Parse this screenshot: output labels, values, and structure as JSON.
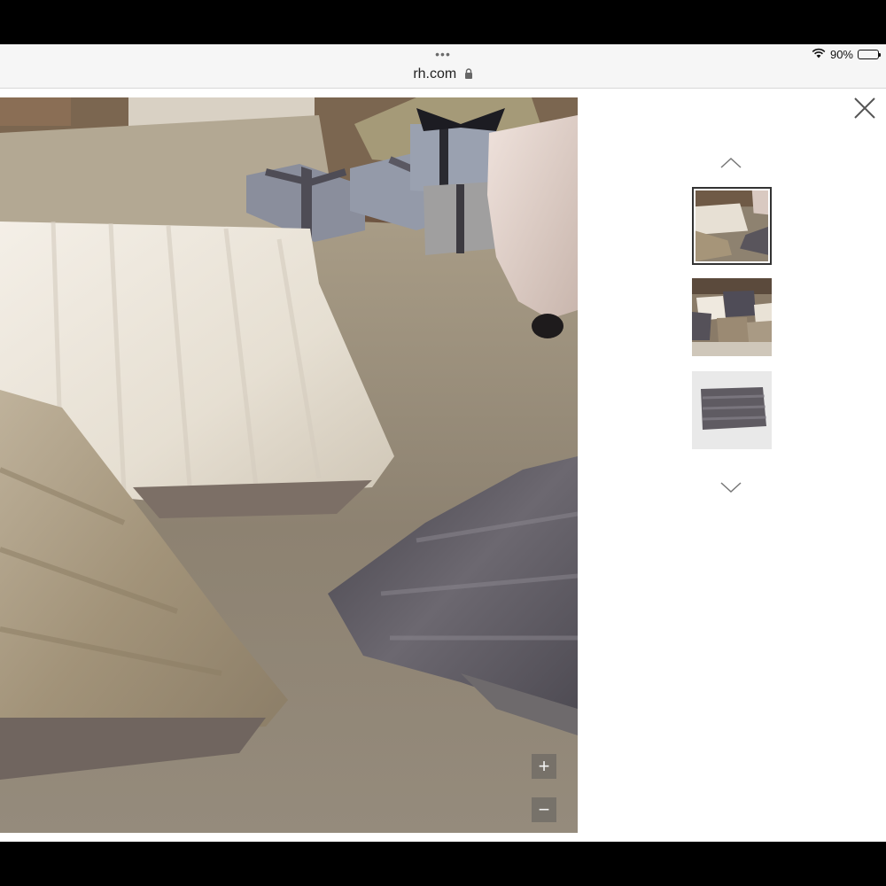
{
  "browser": {
    "menu_dots": "•••",
    "url": "rh.com",
    "lock_icon": "lock-icon",
    "wifi_icon": "wifi-icon",
    "battery_percent": "90%",
    "battery_level": 0.9
  },
  "gallery": {
    "hero_image": "faux-fur-pillows-on-rug-with-gifts",
    "zoom_in_label": "+",
    "zoom_out_label": "−",
    "close_icon": "close-icon",
    "prev_icon": "chevron-up-icon",
    "next_icon": "chevron-down-icon",
    "thumbnails": [
      {
        "name": "thumbnail-1",
        "image": "pillows-on-rug",
        "active": true
      },
      {
        "name": "thumbnail-2",
        "image": "pillows-on-sofa",
        "active": false
      },
      {
        "name": "thumbnail-3",
        "image": "grey-fur-pillow",
        "active": false
      }
    ]
  },
  "colors": {
    "chrome_bg": "#f6f6f6",
    "page_bg": "#ffffff",
    "rug": "#8e8270",
    "ivory_fur": "#ece6dc",
    "tan_fur": "#a8997f",
    "grey_fur": "#5e5a5e"
  }
}
